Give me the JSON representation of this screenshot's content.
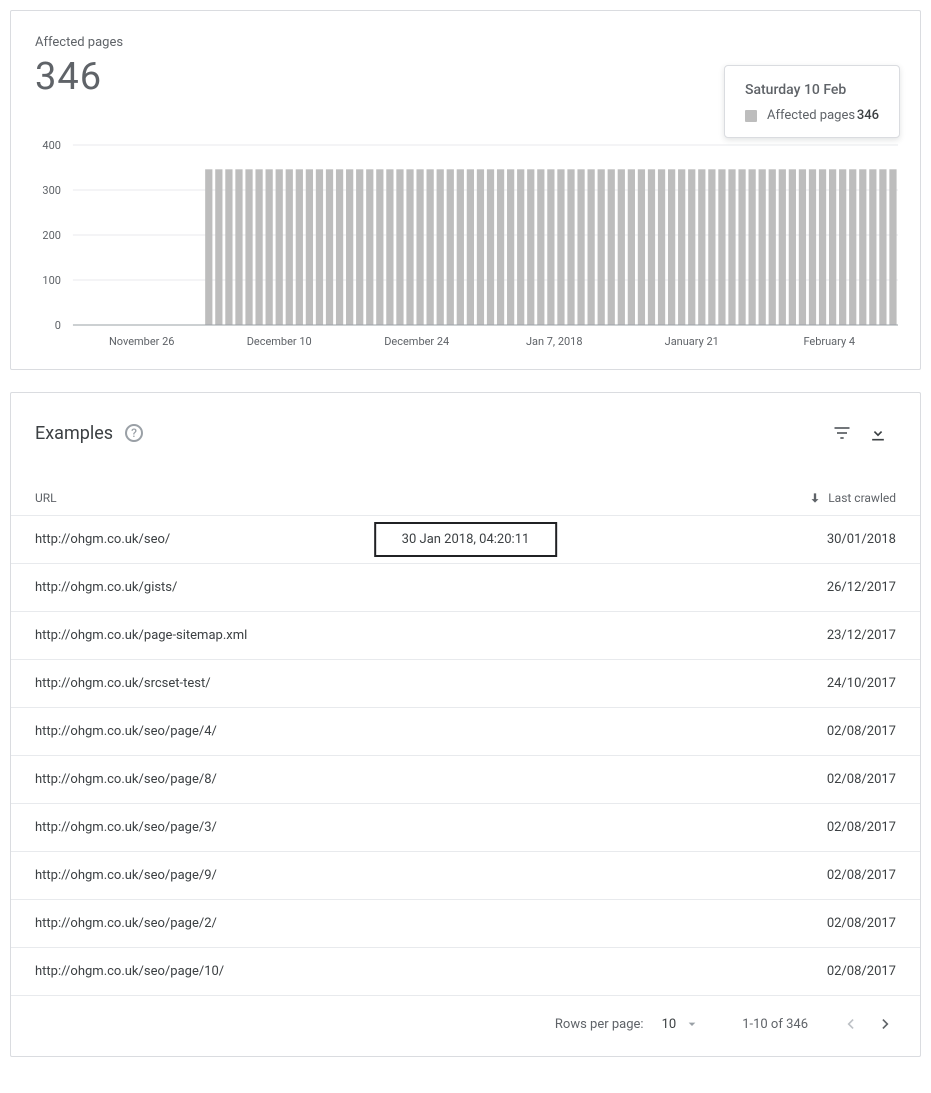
{
  "chart_card": {
    "metric_label": "Affected pages",
    "metric_value": "346"
  },
  "chart_data": {
    "type": "bar",
    "ylabel": "",
    "xlabel": "",
    "ylim": [
      0,
      400
    ],
    "yticks": [
      0,
      100,
      200,
      300,
      400
    ],
    "xticks": [
      "November 26",
      "December 10",
      "December 24",
      "Jan 7, 2018",
      "January 21",
      "February 4"
    ],
    "categories_count": 82,
    "zero_before_index": 13,
    "value_after": 346,
    "tooltip": {
      "title": "Saturday 10 Feb",
      "series_label": "Affected pages",
      "value": "346"
    }
  },
  "examples": {
    "title": "Examples",
    "columns": {
      "url": "URL",
      "crawled": "Last crawled"
    },
    "hover_timestamp": "30 Jan 2018, 04:20:11",
    "rows": [
      {
        "url": "http://ohgm.co.uk/seo/",
        "crawled": "30/01/2018"
      },
      {
        "url": "http://ohgm.co.uk/gists/",
        "crawled": "26/12/2017"
      },
      {
        "url": "http://ohgm.co.uk/page-sitemap.xml",
        "crawled": "23/12/2017"
      },
      {
        "url": "http://ohgm.co.uk/srcset-test/",
        "crawled": "24/10/2017"
      },
      {
        "url": "http://ohgm.co.uk/seo/page/4/",
        "crawled": "02/08/2017"
      },
      {
        "url": "http://ohgm.co.uk/seo/page/8/",
        "crawled": "02/08/2017"
      },
      {
        "url": "http://ohgm.co.uk/seo/page/3/",
        "crawled": "02/08/2017"
      },
      {
        "url": "http://ohgm.co.uk/seo/page/9/",
        "crawled": "02/08/2017"
      },
      {
        "url": "http://ohgm.co.uk/seo/page/2/",
        "crawled": "02/08/2017"
      },
      {
        "url": "http://ohgm.co.uk/seo/page/10/",
        "crawled": "02/08/2017"
      }
    ],
    "footer": {
      "rpp_label": "Rows per page:",
      "rpp_value": "10",
      "range": "1-10 of 346"
    }
  }
}
